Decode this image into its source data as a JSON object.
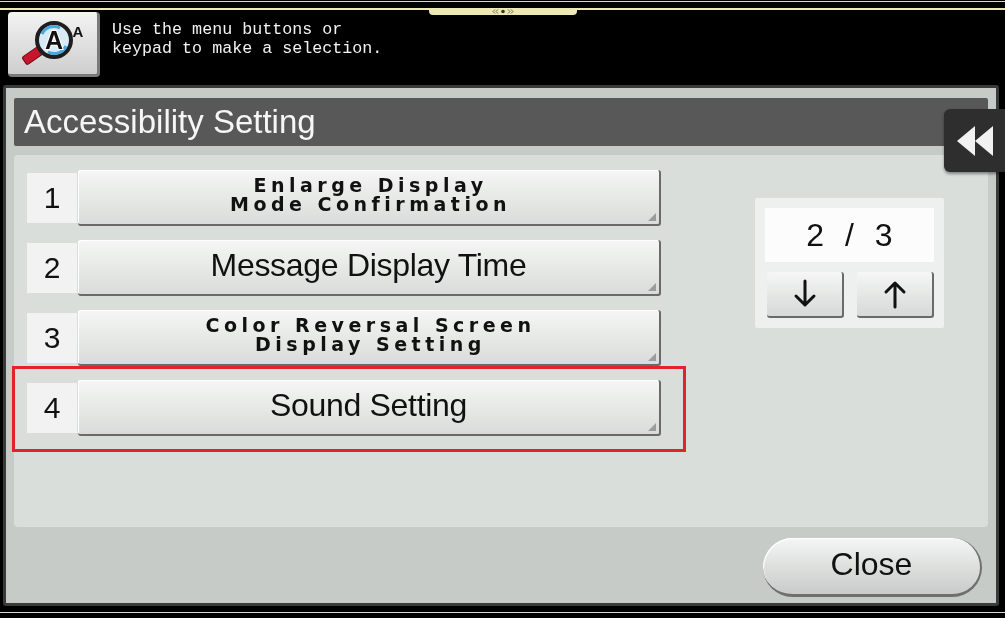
{
  "header": {
    "mode_button": {
      "lens_letter": "A",
      "side_letter": "A"
    },
    "message": "Use the menu buttons or keypad to make a selection."
  },
  "title": "Accessibility Setting",
  "rows": [
    {
      "number": "1",
      "label": "Enlarge Display\nMode Confirmation",
      "kind": "double",
      "highlighted": false
    },
    {
      "number": "2",
      "label": "Message Display Time",
      "kind": "single",
      "highlighted": false
    },
    {
      "number": "3",
      "label": "Color Reversal Screen\nDisplay Setting",
      "kind": "double",
      "highlighted": false
    },
    {
      "number": "4",
      "label": "Sound Setting",
      "kind": "single",
      "highlighted": true
    }
  ],
  "pager": {
    "page": "2 / 3"
  },
  "close_button": {
    "label": "Close"
  }
}
